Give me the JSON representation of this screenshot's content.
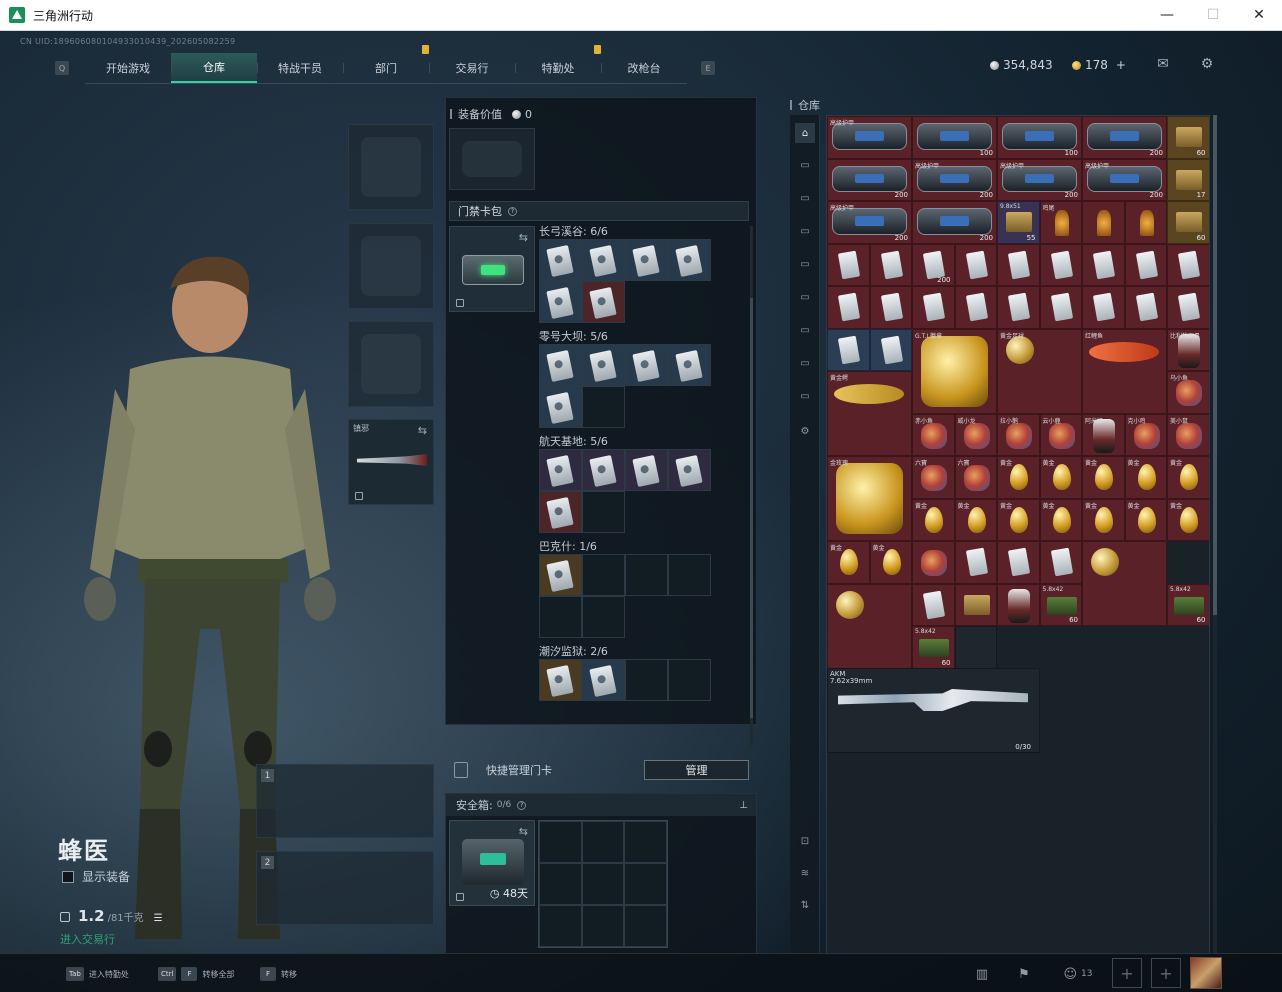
{
  "window": {
    "title": "三角洲行动",
    "controls": {
      "minimize": "—",
      "maximize": "☐",
      "close": "✕"
    }
  },
  "uid": "CN UID:1896060801049330104​39_202605082259",
  "nav": {
    "left_key": "Q",
    "right_key": "E",
    "tabs": [
      {
        "label": "开始游戏",
        "active": false,
        "badge": false
      },
      {
        "label": "仓库",
        "active": true,
        "badge": false
      },
      {
        "label": "特战干员",
        "active": false,
        "badge": false
      },
      {
        "label": "部门",
        "active": false,
        "badge": true
      },
      {
        "label": "交易行",
        "active": false,
        "badge": false
      },
      {
        "label": "特勤处",
        "active": false,
        "badge": true
      },
      {
        "label": "改枪台",
        "active": false,
        "badge": false
      }
    ]
  },
  "currency": {
    "silver": "354,843",
    "gold": "178",
    "gold_plus": "+",
    "mail_icon": "mail-icon",
    "settings_icon": "gear-icon"
  },
  "operator": {
    "name": "蜂医",
    "show_equipment": "显示装备",
    "weight_value": "1.2",
    "weight_max": "/81千克",
    "status": "进入交易行"
  },
  "equip_slots": {
    "melee_label": "镇邪"
  },
  "middle": {
    "equip_value_label": "装备价值",
    "equip_value": "0",
    "cardpack_title": "门禁卡包",
    "groups": [
      {
        "title": "长弓溪谷: 6/6"
      },
      {
        "title": "零号大坝: 5/6"
      },
      {
        "title": "航天基地: 5/6"
      },
      {
        "title": "巴克什: 1/6"
      },
      {
        "title": "潮汐监狱: 2/6"
      }
    ],
    "quick_manage": "快捷管理门卡",
    "manage_button": "管理",
    "safe_label": "安全箱:",
    "safe_count": "0/6",
    "safe_time": "48天"
  },
  "stash": {
    "title": "仓库",
    "rows": [
      [
        {
          "t": "red",
          "i": "bag",
          "l": "高级护甲",
          "v": ""
        },
        {
          "t": "red",
          "i": "bag",
          "l": "",
          "v": "100"
        },
        {
          "t": "red",
          "i": "bag",
          "l": "",
          "v": "100"
        },
        {
          "t": "red",
          "i": "bag",
          "l": "",
          "v": "200"
        },
        {
          "t": "gold",
          "i": "box",
          "l": "",
          "v": "60"
        }
      ],
      [
        {
          "t": "red",
          "i": "bag",
          "l": "",
          "v": "200"
        },
        {
          "t": "red",
          "i": "bag",
          "l": "高级护甲",
          "v": "200"
        },
        {
          "t": "red",
          "i": "bag",
          "l": "高级护甲",
          "v": "200"
        },
        {
          "t": "red",
          "i": "bag",
          "l": "高级护甲",
          "v": "200"
        },
        {
          "t": "gold",
          "i": "box",
          "l": "",
          "v": "17"
        }
      ],
      [
        {
          "t": "red",
          "i": "bag",
          "l": "高级护甲",
          "v": "200"
        },
        {
          "t": "red",
          "i": "bag",
          "l": "",
          "v": "200"
        },
        {
          "t": "purple",
          "i": "box",
          "l": "9.8x51",
          "v": "55"
        },
        {
          "t": "red",
          "i": "drink",
          "l": "鸡尾",
          "v": ""
        },
        {
          "t": "red",
          "i": "drink",
          "l": "",
          "v": ""
        },
        {
          "t": "red",
          "i": "drink",
          "l": "",
          "v": ""
        },
        {
          "t": "gold",
          "i": "box",
          "l": "",
          "v": "60"
        }
      ],
      [
        {
          "t": "red",
          "i": "card",
          "l": "",
          "v": ""
        },
        {
          "t": "red",
          "i": "card",
          "l": "",
          "v": ""
        },
        {
          "t": "red",
          "i": "card",
          "l": "",
          "v": "200"
        },
        {
          "t": "red",
          "i": "card",
          "l": "",
          "v": ""
        },
        {
          "t": "red",
          "i": "card",
          "l": "",
          "v": ""
        },
        {
          "t": "red",
          "i": "card",
          "l": "",
          "v": ""
        },
        {
          "t": "red",
          "i": "card",
          "l": "",
          "v": ""
        },
        {
          "t": "red",
          "i": "card",
          "l": "",
          "v": ""
        },
        {
          "t": "red",
          "i": "card",
          "l": "",
          "v": ""
        }
      ],
      [
        {
          "t": "red",
          "i": "card",
          "l": "",
          "v": ""
        },
        {
          "t": "red",
          "i": "card",
          "l": "",
          "v": ""
        },
        {
          "t": "red",
          "i": "card",
          "l": "",
          "v": ""
        },
        {
          "t": "red",
          "i": "card",
          "l": "",
          "v": ""
        },
        {
          "t": "red",
          "i": "card",
          "l": "",
          "v": ""
        },
        {
          "t": "red",
          "i": "card",
          "l": "",
          "v": ""
        },
        {
          "t": "red",
          "i": "card",
          "l": "",
          "v": ""
        },
        {
          "t": "red",
          "i": "card",
          "l": "",
          "v": ""
        },
        {
          "t": "red",
          "i": "card",
          "l": "",
          "v": ""
        }
      ],
      [
        {
          "t": "blue",
          "i": "card",
          "l": "",
          "v": ""
        },
        {
          "t": "blue",
          "i": "card",
          "l": "",
          "v": ""
        },
        {
          "t": "red",
          "i": "gold",
          "l": "G.T.I.徽章",
          "v": ""
        },
        {
          "t": "red",
          "i": "ball",
          "l": "黄金足球",
          "v": ""
        },
        {
          "t": "red",
          "i": "fish",
          "l": "红鲤鱼",
          "v": ""
        },
        {
          "t": "red",
          "i": "figure",
          "l": "比利的面具",
          "v": ""
        }
      ],
      [
        {
          "t": "red",
          "i": "fish",
          "l": "黄金鳄",
          "v": ""
        },
        {
          "t": "red",
          "i": "toy",
          "l": "乌小鱼",
          "v": ""
        }
      ],
      [
        {
          "t": "red",
          "i": "toy",
          "l": "赤小鱼",
          "v": ""
        },
        {
          "t": "red",
          "i": "toy",
          "l": "威小龙",
          "v": ""
        },
        {
          "t": "red",
          "i": "toy",
          "l": "拉小鹅",
          "v": ""
        },
        {
          "t": "red",
          "i": "toy",
          "l": "云小鹿",
          "v": ""
        },
        {
          "t": "red",
          "i": "figure",
          "l": "阿米娅",
          "v": ""
        }
      ],
      [
        {
          "t": "red",
          "i": "toy",
          "l": "克小鸡",
          "v": ""
        },
        {
          "t": "red",
          "i": "toy",
          "l": "美小鼠",
          "v": ""
        },
        {
          "t": "red",
          "i": "gold",
          "l": "金玫瑰",
          "v": ""
        },
        {
          "t": "red",
          "i": "toy",
          "l": "六寶",
          "v": ""
        },
        {
          "t": "red",
          "i": "toy",
          "l": "六寶",
          "v": ""
        }
      ],
      [
        {
          "t": "red",
          "i": "egg",
          "l": "黄金",
          "v": ""
        },
        {
          "t": "red",
          "i": "egg",
          "l": "黄金",
          "v": ""
        },
        {
          "t": "red",
          "i": "egg",
          "l": "黄金",
          "v": ""
        },
        {
          "t": "red",
          "i": "egg",
          "l": "黄金",
          "v": ""
        },
        {
          "t": "red",
          "i": "egg",
          "l": "黄金",
          "v": ""
        },
        {
          "t": "red",
          "i": "egg",
          "l": "黄金",
          "v": ""
        },
        {
          "t": "red",
          "i": "egg",
          "l": "黄金",
          "v": ""
        },
        {
          "t": "red",
          "i": "egg",
          "l": "黄金",
          "v": ""
        },
        {
          "t": "red",
          "i": "egg",
          "l": "黄金",
          "v": ""
        }
      ],
      [
        {
          "t": "red",
          "i": "egg",
          "l": "黄金",
          "v": ""
        },
        {
          "t": "red",
          "i": "egg",
          "l": "黄金",
          "v": ""
        },
        {
          "t": "red",
          "i": "egg",
          "l": "黄金",
          "v": ""
        },
        {
          "t": "red",
          "i": "egg",
          "l": "黄金",
          "v": ""
        },
        {
          "t": "red",
          "i": "egg",
          "l": "黄金",
          "v": ""
        },
        {
          "t": "red",
          "i": "toy",
          "l": "",
          "v": ""
        },
        {
          "t": "red",
          "i": "card",
          "l": "",
          "v": ""
        },
        {
          "t": "red",
          "i": "card",
          "l": "",
          "v": ""
        },
        {
          "t": "red",
          "i": "card",
          "l": "",
          "v": ""
        }
      ],
      [
        {
          "t": "red",
          "i": "ball",
          "l": "",
          "v": ""
        },
        {
          "t": "red",
          "i": "ball",
          "l": "",
          "v": ""
        },
        {
          "t": "red",
          "i": "card",
          "l": "",
          "v": ""
        },
        {
          "t": "red",
          "i": "box",
          "l": "",
          "v": ""
        },
        {
          "t": "red",
          "i": "figure",
          "l": "",
          "v": ""
        },
        {
          "t": "red",
          "i": "ammo",
          "l": "5.8x42",
          "v": "60"
        },
        {
          "t": "red",
          "i": "ammo",
          "l": "5.8x42",
          "v": "60"
        },
        {
          "t": "red",
          "i": "ammo",
          "l": "5.8x42",
          "v": "60"
        },
        {
          "t": "empty",
          "i": "",
          "l": "",
          "v": ""
        }
      ]
    ],
    "rifle": {
      "name": "AKM",
      "caliber": "7.62x39mm",
      "ammo": "0/30"
    }
  },
  "bottom": {
    "hints": [
      {
        "key": "Tab",
        "label": "进入特勤处"
      },
      {
        "key": "Ctrl",
        "key2": "F",
        "label": "转移全部"
      },
      {
        "key": "F",
        "label": "转移"
      }
    ],
    "squad_count": "13"
  }
}
